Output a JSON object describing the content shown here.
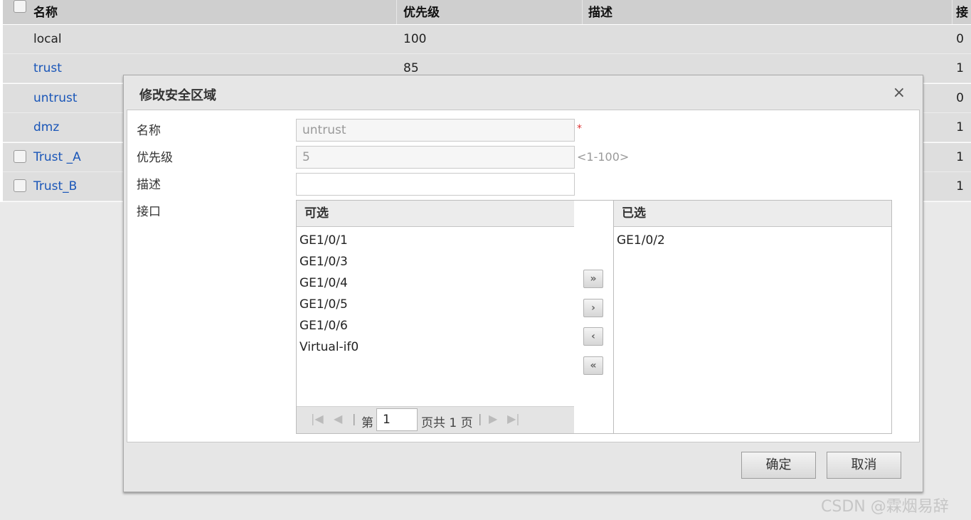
{
  "table": {
    "headers": {
      "name": "名称",
      "priority": "优先级",
      "description": "描述",
      "interface_trunc": "接"
    },
    "rows": [
      {
        "name": "local",
        "priority": "100",
        "ifaces": "0"
      },
      {
        "name": "trust",
        "priority": "85",
        "ifaces": "1"
      },
      {
        "name": "untrust",
        "priority": "",
        "ifaces": "0"
      },
      {
        "name": "dmz",
        "priority": "",
        "ifaces": "1"
      },
      {
        "name": "Trust _A",
        "priority": "",
        "ifaces": "1"
      },
      {
        "name": "Trust_B",
        "priority": "",
        "ifaces": "1"
      }
    ]
  },
  "dialog": {
    "title": "修改安全区域",
    "close_icon": "×",
    "fields": {
      "name_label": "名称",
      "name_value": "untrust",
      "required_mark": "*",
      "priority_label": "优先级",
      "priority_value": "5",
      "priority_range": "<1-100>",
      "description_label": "描述",
      "description_value": "",
      "interface_label": "接口"
    },
    "available": {
      "header": "可选",
      "items": [
        "GE1/0/1",
        "GE1/0/3",
        "GE1/0/4",
        "GE1/0/5",
        "GE1/0/6",
        "Virtual-if0"
      ],
      "pager": {
        "page_prefix": "第",
        "page_value": "1",
        "page_suffix": "页共 1 页"
      }
    },
    "selected": {
      "header": "已选",
      "items": [
        "GE1/0/2"
      ]
    },
    "move_buttons": {
      "add_all": "»",
      "add_one": "›",
      "remove_one": "‹",
      "remove_all": "«"
    },
    "buttons": {
      "ok": "确定",
      "cancel": "取消"
    }
  },
  "watermark": "CSDN @霖烟易辞"
}
